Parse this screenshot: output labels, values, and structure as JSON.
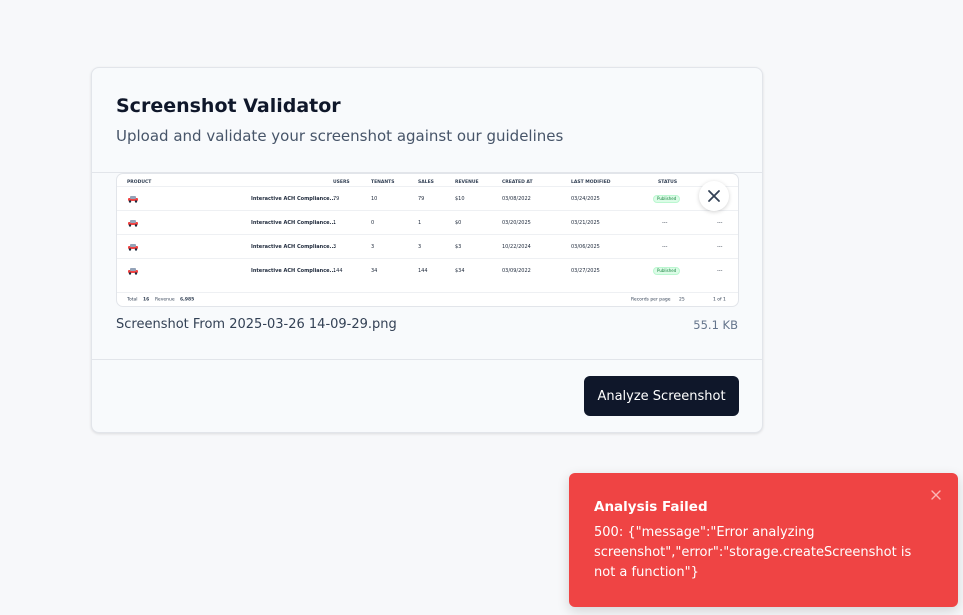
{
  "card": {
    "title": "Screenshot Validator",
    "subtitle": "Upload and validate your screenshot against our guidelines"
  },
  "preview": {
    "columns": [
      "PRODUCT",
      "USERS",
      "TENANTS",
      "SALES",
      "REVENUE",
      "CREATED AT",
      "LAST MODIFIED",
      "STATUS"
    ],
    "rows": [
      {
        "product": "Interactive ACH Compliance...",
        "users": "79",
        "tenants": "10",
        "sales": "79",
        "revenue": "$10",
        "created": "03/08/2022",
        "modified": "03/24/2025",
        "status": "Published",
        "more": "---"
      },
      {
        "product": "Interactive ACH Compliance...",
        "users": "1",
        "tenants": "0",
        "sales": "1",
        "revenue": "$0",
        "created": "03/20/2025",
        "modified": "03/21/2025",
        "status": "---",
        "more": "---"
      },
      {
        "product": "Interactive ACH Compliance...",
        "users": "3",
        "tenants": "3",
        "sales": "3",
        "revenue": "$3",
        "created": "10/22/2024",
        "modified": "03/06/2025",
        "status": "---",
        "more": "---"
      },
      {
        "product": "Interactive ACH Compliance...",
        "users": "144",
        "tenants": "34",
        "sales": "144",
        "revenue": "$34",
        "created": "03/09/2022",
        "modified": "03/27/2025",
        "status": "Published",
        "more": "---"
      }
    ],
    "footer": {
      "total_label": "Total",
      "total_value": "16",
      "revenue_label": "Revenue",
      "revenue_value": "6,985",
      "records_label": "Records per page",
      "records_value": "25",
      "page_info": "1 of 1"
    }
  },
  "file": {
    "name": "Screenshot From 2025-03-26 14-09-29.png",
    "size": "55.1 KB"
  },
  "analyze_label": "Analyze Screenshot",
  "toast": {
    "title": "Analysis Failed",
    "message": "500: {\"message\":\"Error analyzing screenshot\",\"error\":\"storage.createScreenshot is not a function\"}"
  },
  "colors": {
    "background": "#f7f8fa",
    "card": "#f8fafc",
    "primary_button": "#0f172a",
    "toast": "#ef4444",
    "badge": "#dcfce7"
  },
  "icons": {
    "remove": "close-icon",
    "toast_close": "close-icon",
    "product": "car-icon"
  }
}
